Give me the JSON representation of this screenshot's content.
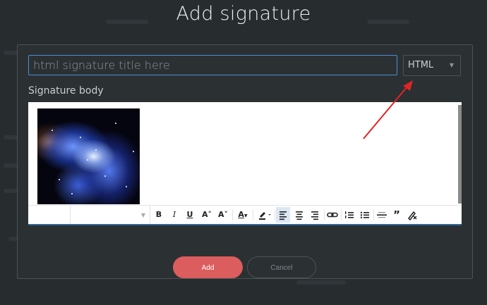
{
  "dialog": {
    "title": "Add signature",
    "title_input": {
      "placeholder": "html signature title here",
      "value": ""
    },
    "format_select": {
      "selected": "HTML"
    },
    "body_label": "Signature body",
    "buttons": {
      "add": "Add",
      "cancel": "Cancel"
    }
  },
  "toolbar": {
    "bold": "B",
    "italic": "I",
    "underline": "U",
    "superscript": "A˄",
    "subscript": "A˅",
    "font_color": "A",
    "quote": "”"
  },
  "colors": {
    "add_button": "#db5d5d",
    "annotation_arrow": "#e02424",
    "input_focus": "#4b8fd6"
  },
  "annotation": {
    "type": "arrow",
    "points_to": "format-select"
  }
}
